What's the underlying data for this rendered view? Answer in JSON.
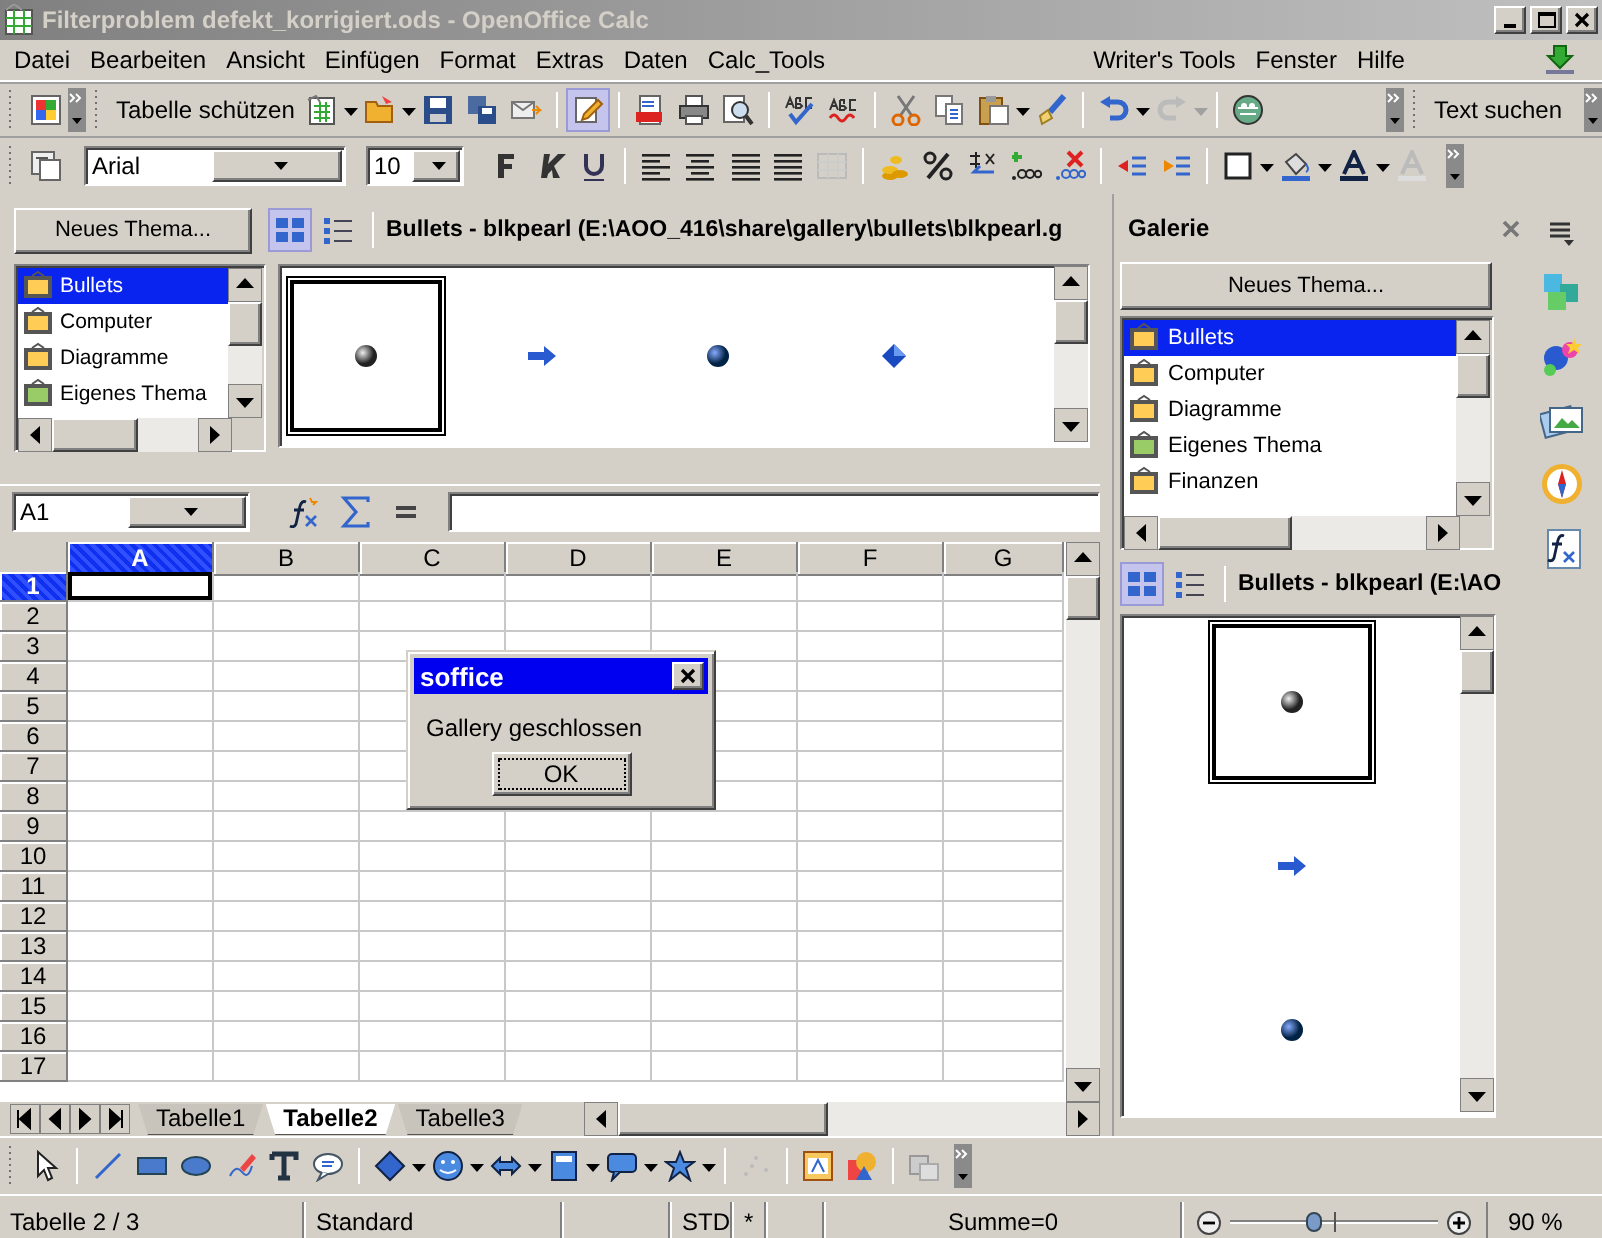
{
  "window": {
    "title": "Filterproblem defekt_korrigiert.ods - OpenOffice Calc"
  },
  "menu": [
    {
      "label": "Datei"
    },
    {
      "label": "Bearbeiten"
    },
    {
      "label": "Ansicht"
    },
    {
      "label": "Einfügen"
    },
    {
      "label": "Format"
    },
    {
      "label": "Extras"
    },
    {
      "label": "Daten"
    },
    {
      "label": "Calc_Tools"
    },
    {
      "label": "Writer's Tools"
    },
    {
      "label": "Fenster"
    },
    {
      "label": "Hilfe"
    }
  ],
  "standard_toolbar": {
    "protect_button": "Tabelle schützen",
    "edit_file_on": true,
    "find_label": "Text suchen"
  },
  "formatting_toolbar": {
    "font": "Arial",
    "size": "10"
  },
  "gallery": {
    "new_theme_button": "Neues Thema...",
    "view_modes": [
      {
        "kind": "icons",
        "selected": true
      },
      {
        "kind": "details",
        "selected": false
      }
    ],
    "path_title": "Bullets - blkpearl (E:\\AOO_416\\share\\gallery\\bullets\\blkpearl.g",
    "themes": [
      {
        "label": "Bullets",
        "kind": "builtin",
        "selected": true
      },
      {
        "label": "Computer",
        "kind": "builtin",
        "selected": false
      },
      {
        "label": "Diagramme",
        "kind": "builtin",
        "selected": false
      },
      {
        "label": "Eigenes Thema",
        "kind": "user",
        "selected": false
      }
    ],
    "items": [
      {
        "kind": "pearl",
        "selected": true
      },
      {
        "kind": "arrow",
        "selected": false
      },
      {
        "kind": "sphere",
        "selected": false
      },
      {
        "kind": "diamond",
        "selected": false
      }
    ]
  },
  "formula_bar": {
    "cell_reference": "A1"
  },
  "sheet": {
    "columns": [
      {
        "label": "A",
        "selected": true
      },
      {
        "label": "B",
        "selected": false
      },
      {
        "label": "C",
        "selected": false
      },
      {
        "label": "D",
        "selected": false
      },
      {
        "label": "E",
        "selected": false
      },
      {
        "label": "F",
        "selected": false
      },
      {
        "label": "G",
        "selected": false
      }
    ],
    "rows": [
      {
        "label": "1",
        "selected": true
      },
      {
        "label": "2",
        "selected": false
      },
      {
        "label": "3",
        "selected": false
      },
      {
        "label": "4",
        "selected": false
      },
      {
        "label": "5",
        "selected": false
      },
      {
        "label": "6",
        "selected": false
      },
      {
        "label": "7",
        "selected": false
      },
      {
        "label": "8",
        "selected": false
      },
      {
        "label": "9",
        "selected": false
      },
      {
        "label": "10",
        "selected": false
      },
      {
        "label": "11",
        "selected": false
      },
      {
        "label": "12",
        "selected": false
      },
      {
        "label": "13",
        "selected": false
      },
      {
        "label": "14",
        "selected": false
      },
      {
        "label": "15",
        "selected": false
      },
      {
        "label": "16",
        "selected": false
      },
      {
        "label": "17",
        "selected": false
      }
    ],
    "tabs": [
      {
        "label": "Tabelle1",
        "selected": false
      },
      {
        "label": "Tabelle2",
        "selected": true
      },
      {
        "label": "Tabelle3",
        "selected": false
      }
    ]
  },
  "dialog": {
    "title": "soffice",
    "message": "Gallery geschlossen",
    "button": "OK"
  },
  "sidebar": {
    "title": "Galerie",
    "new_theme_button": "Neues Thema...",
    "themes": [
      {
        "label": "Bullets",
        "kind": "builtin",
        "selected": true
      },
      {
        "label": "Computer",
        "kind": "builtin",
        "selected": false
      },
      {
        "label": "Diagramme",
        "kind": "builtin",
        "selected": false
      },
      {
        "label": "Eigenes Thema",
        "kind": "user",
        "selected": false
      },
      {
        "label": "Finanzen",
        "kind": "builtin",
        "selected": false
      }
    ],
    "view_modes": [
      {
        "kind": "icons",
        "selected": true
      },
      {
        "kind": "details",
        "selected": false
      }
    ],
    "path_title": "Bullets - blkpearl (E:\\AO",
    "items": [
      {
        "kind": "pearl",
        "selected": true
      },
      {
        "kind": "arrow",
        "selected": false
      },
      {
        "kind": "sphere",
        "selected": false
      }
    ]
  },
  "status_bar": {
    "sheet": "Tabelle 2 / 3",
    "page_style": "Standard",
    "selection_mode": "STD",
    "modified": "*",
    "sum": "Summe=0",
    "zoom": {
      "level": 0.4,
      "reading": "90 %"
    }
  }
}
